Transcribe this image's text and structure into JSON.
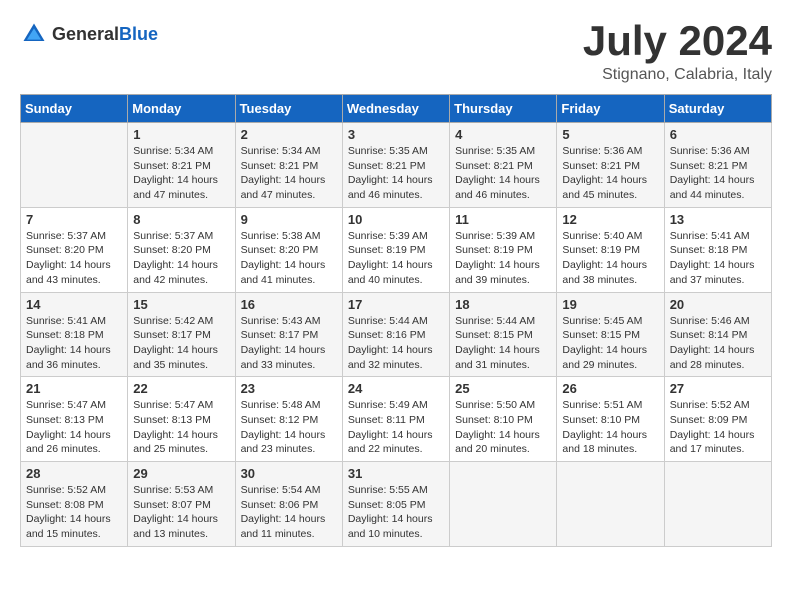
{
  "header": {
    "logo_general": "General",
    "logo_blue": "Blue",
    "month_year": "July 2024",
    "location": "Stignano, Calabria, Italy"
  },
  "weekdays": [
    "Sunday",
    "Monday",
    "Tuesday",
    "Wednesday",
    "Thursday",
    "Friday",
    "Saturday"
  ],
  "weeks": [
    [
      {
        "day": "",
        "sunrise": "",
        "sunset": "",
        "daylight": ""
      },
      {
        "day": "1",
        "sunrise": "Sunrise: 5:34 AM",
        "sunset": "Sunset: 8:21 PM",
        "daylight": "Daylight: 14 hours and 47 minutes."
      },
      {
        "day": "2",
        "sunrise": "Sunrise: 5:34 AM",
        "sunset": "Sunset: 8:21 PM",
        "daylight": "Daylight: 14 hours and 47 minutes."
      },
      {
        "day": "3",
        "sunrise": "Sunrise: 5:35 AM",
        "sunset": "Sunset: 8:21 PM",
        "daylight": "Daylight: 14 hours and 46 minutes."
      },
      {
        "day": "4",
        "sunrise": "Sunrise: 5:35 AM",
        "sunset": "Sunset: 8:21 PM",
        "daylight": "Daylight: 14 hours and 46 minutes."
      },
      {
        "day": "5",
        "sunrise": "Sunrise: 5:36 AM",
        "sunset": "Sunset: 8:21 PM",
        "daylight": "Daylight: 14 hours and 45 minutes."
      },
      {
        "day": "6",
        "sunrise": "Sunrise: 5:36 AM",
        "sunset": "Sunset: 8:21 PM",
        "daylight": "Daylight: 14 hours and 44 minutes."
      }
    ],
    [
      {
        "day": "7",
        "sunrise": "Sunrise: 5:37 AM",
        "sunset": "Sunset: 8:20 PM",
        "daylight": "Daylight: 14 hours and 43 minutes."
      },
      {
        "day": "8",
        "sunrise": "Sunrise: 5:37 AM",
        "sunset": "Sunset: 8:20 PM",
        "daylight": "Daylight: 14 hours and 42 minutes."
      },
      {
        "day": "9",
        "sunrise": "Sunrise: 5:38 AM",
        "sunset": "Sunset: 8:20 PM",
        "daylight": "Daylight: 14 hours and 41 minutes."
      },
      {
        "day": "10",
        "sunrise": "Sunrise: 5:39 AM",
        "sunset": "Sunset: 8:19 PM",
        "daylight": "Daylight: 14 hours and 40 minutes."
      },
      {
        "day": "11",
        "sunrise": "Sunrise: 5:39 AM",
        "sunset": "Sunset: 8:19 PM",
        "daylight": "Daylight: 14 hours and 39 minutes."
      },
      {
        "day": "12",
        "sunrise": "Sunrise: 5:40 AM",
        "sunset": "Sunset: 8:19 PM",
        "daylight": "Daylight: 14 hours and 38 minutes."
      },
      {
        "day": "13",
        "sunrise": "Sunrise: 5:41 AM",
        "sunset": "Sunset: 8:18 PM",
        "daylight": "Daylight: 14 hours and 37 minutes."
      }
    ],
    [
      {
        "day": "14",
        "sunrise": "Sunrise: 5:41 AM",
        "sunset": "Sunset: 8:18 PM",
        "daylight": "Daylight: 14 hours and 36 minutes."
      },
      {
        "day": "15",
        "sunrise": "Sunrise: 5:42 AM",
        "sunset": "Sunset: 8:17 PM",
        "daylight": "Daylight: 14 hours and 35 minutes."
      },
      {
        "day": "16",
        "sunrise": "Sunrise: 5:43 AM",
        "sunset": "Sunset: 8:17 PM",
        "daylight": "Daylight: 14 hours and 33 minutes."
      },
      {
        "day": "17",
        "sunrise": "Sunrise: 5:44 AM",
        "sunset": "Sunset: 8:16 PM",
        "daylight": "Daylight: 14 hours and 32 minutes."
      },
      {
        "day": "18",
        "sunrise": "Sunrise: 5:44 AM",
        "sunset": "Sunset: 8:15 PM",
        "daylight": "Daylight: 14 hours and 31 minutes."
      },
      {
        "day": "19",
        "sunrise": "Sunrise: 5:45 AM",
        "sunset": "Sunset: 8:15 PM",
        "daylight": "Daylight: 14 hours and 29 minutes."
      },
      {
        "day": "20",
        "sunrise": "Sunrise: 5:46 AM",
        "sunset": "Sunset: 8:14 PM",
        "daylight": "Daylight: 14 hours and 28 minutes."
      }
    ],
    [
      {
        "day": "21",
        "sunrise": "Sunrise: 5:47 AM",
        "sunset": "Sunset: 8:13 PM",
        "daylight": "Daylight: 14 hours and 26 minutes."
      },
      {
        "day": "22",
        "sunrise": "Sunrise: 5:47 AM",
        "sunset": "Sunset: 8:13 PM",
        "daylight": "Daylight: 14 hours and 25 minutes."
      },
      {
        "day": "23",
        "sunrise": "Sunrise: 5:48 AM",
        "sunset": "Sunset: 8:12 PM",
        "daylight": "Daylight: 14 hours and 23 minutes."
      },
      {
        "day": "24",
        "sunrise": "Sunrise: 5:49 AM",
        "sunset": "Sunset: 8:11 PM",
        "daylight": "Daylight: 14 hours and 22 minutes."
      },
      {
        "day": "25",
        "sunrise": "Sunrise: 5:50 AM",
        "sunset": "Sunset: 8:10 PM",
        "daylight": "Daylight: 14 hours and 20 minutes."
      },
      {
        "day": "26",
        "sunrise": "Sunrise: 5:51 AM",
        "sunset": "Sunset: 8:10 PM",
        "daylight": "Daylight: 14 hours and 18 minutes."
      },
      {
        "day": "27",
        "sunrise": "Sunrise: 5:52 AM",
        "sunset": "Sunset: 8:09 PM",
        "daylight": "Daylight: 14 hours and 17 minutes."
      }
    ],
    [
      {
        "day": "28",
        "sunrise": "Sunrise: 5:52 AM",
        "sunset": "Sunset: 8:08 PM",
        "daylight": "Daylight: 14 hours and 15 minutes."
      },
      {
        "day": "29",
        "sunrise": "Sunrise: 5:53 AM",
        "sunset": "Sunset: 8:07 PM",
        "daylight": "Daylight: 14 hours and 13 minutes."
      },
      {
        "day": "30",
        "sunrise": "Sunrise: 5:54 AM",
        "sunset": "Sunset: 8:06 PM",
        "daylight": "Daylight: 14 hours and 11 minutes."
      },
      {
        "day": "31",
        "sunrise": "Sunrise: 5:55 AM",
        "sunset": "Sunset: 8:05 PM",
        "daylight": "Daylight: 14 hours and 10 minutes."
      },
      {
        "day": "",
        "sunrise": "",
        "sunset": "",
        "daylight": ""
      },
      {
        "day": "",
        "sunrise": "",
        "sunset": "",
        "daylight": ""
      },
      {
        "day": "",
        "sunrise": "",
        "sunset": "",
        "daylight": ""
      }
    ]
  ]
}
